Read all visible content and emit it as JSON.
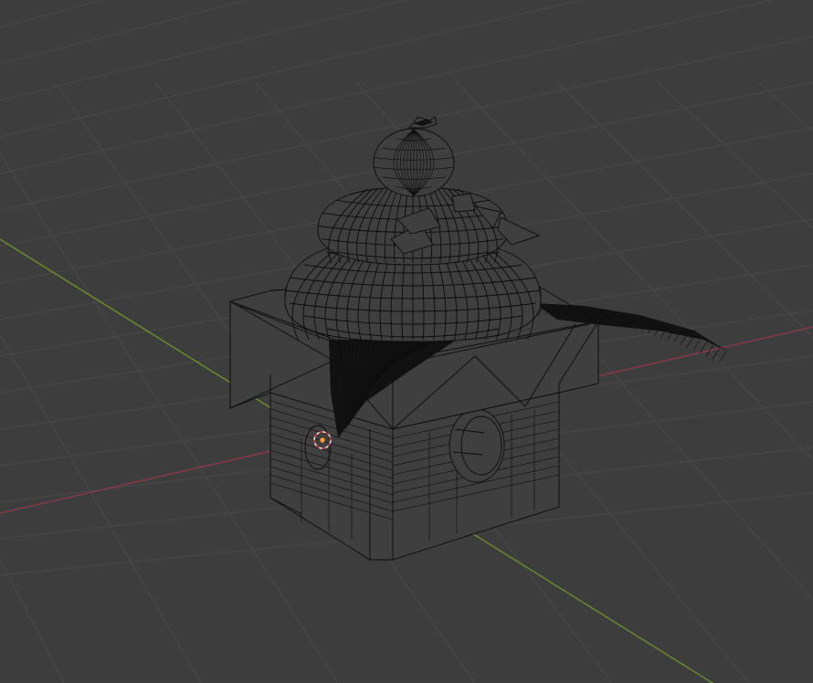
{
  "viewport": {
    "view_mode": "wireframe",
    "background_color": "#3d3d3d",
    "grid_color": "#4a4a4a",
    "x_axis_color": "#8b3b45",
    "y_axis_color": "#6a8e2c",
    "wire_color": "#0b0b0b",
    "origin_color": "#ffa030"
  },
  "scene": {
    "object_icon": "kagami-mochi-mesh-icon",
    "cursor_icon": "3d-cursor-icon"
  }
}
